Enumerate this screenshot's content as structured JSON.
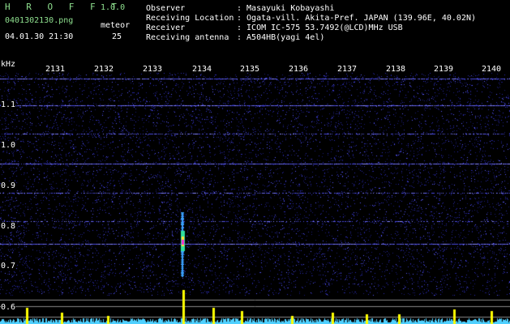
{
  "app": {
    "name": "H R O F F T",
    "version": "1.0.0"
  },
  "file": {
    "name": "0401302130.png",
    "datetime": "04.01.30 21:30"
  },
  "meteor": {
    "label": "meteor",
    "count": "25"
  },
  "info": {
    "observer_label": "Observer",
    "observer_value": ": Masayuki Kobayashi",
    "location_label": "Receiving Location",
    "location_value": ": Ogata-vill. Akita-Pref. JAPAN (139.96E, 40.02N)",
    "receiver_label": "Receiver",
    "receiver_value": ": ICOM IC-575 53.7492(@LCD)MHz USB",
    "antenna_label": "Receiving antenna",
    "antenna_value": ": A504HB(yagi 4el)"
  },
  "y_axis": {
    "unit": "kHz",
    "ticks": [
      "1.1",
      "1.0",
      "0.9",
      "0.8",
      "0.7",
      "0.6"
    ]
  },
  "x_axis": {
    "ticks": [
      "2131",
      "2132",
      "2133",
      "2134",
      "2135",
      "2136",
      "2137",
      "2138",
      "2139",
      "2140"
    ]
  },
  "colors": {
    "background": "#000000",
    "noise": "#2a2aa8",
    "carrier_lines": "#6d6dff",
    "meteor_core": "#ff2ad4",
    "spectrum": "#4fd0ff",
    "peaks": "#ffff00",
    "header_green": "#8fe08f"
  }
}
